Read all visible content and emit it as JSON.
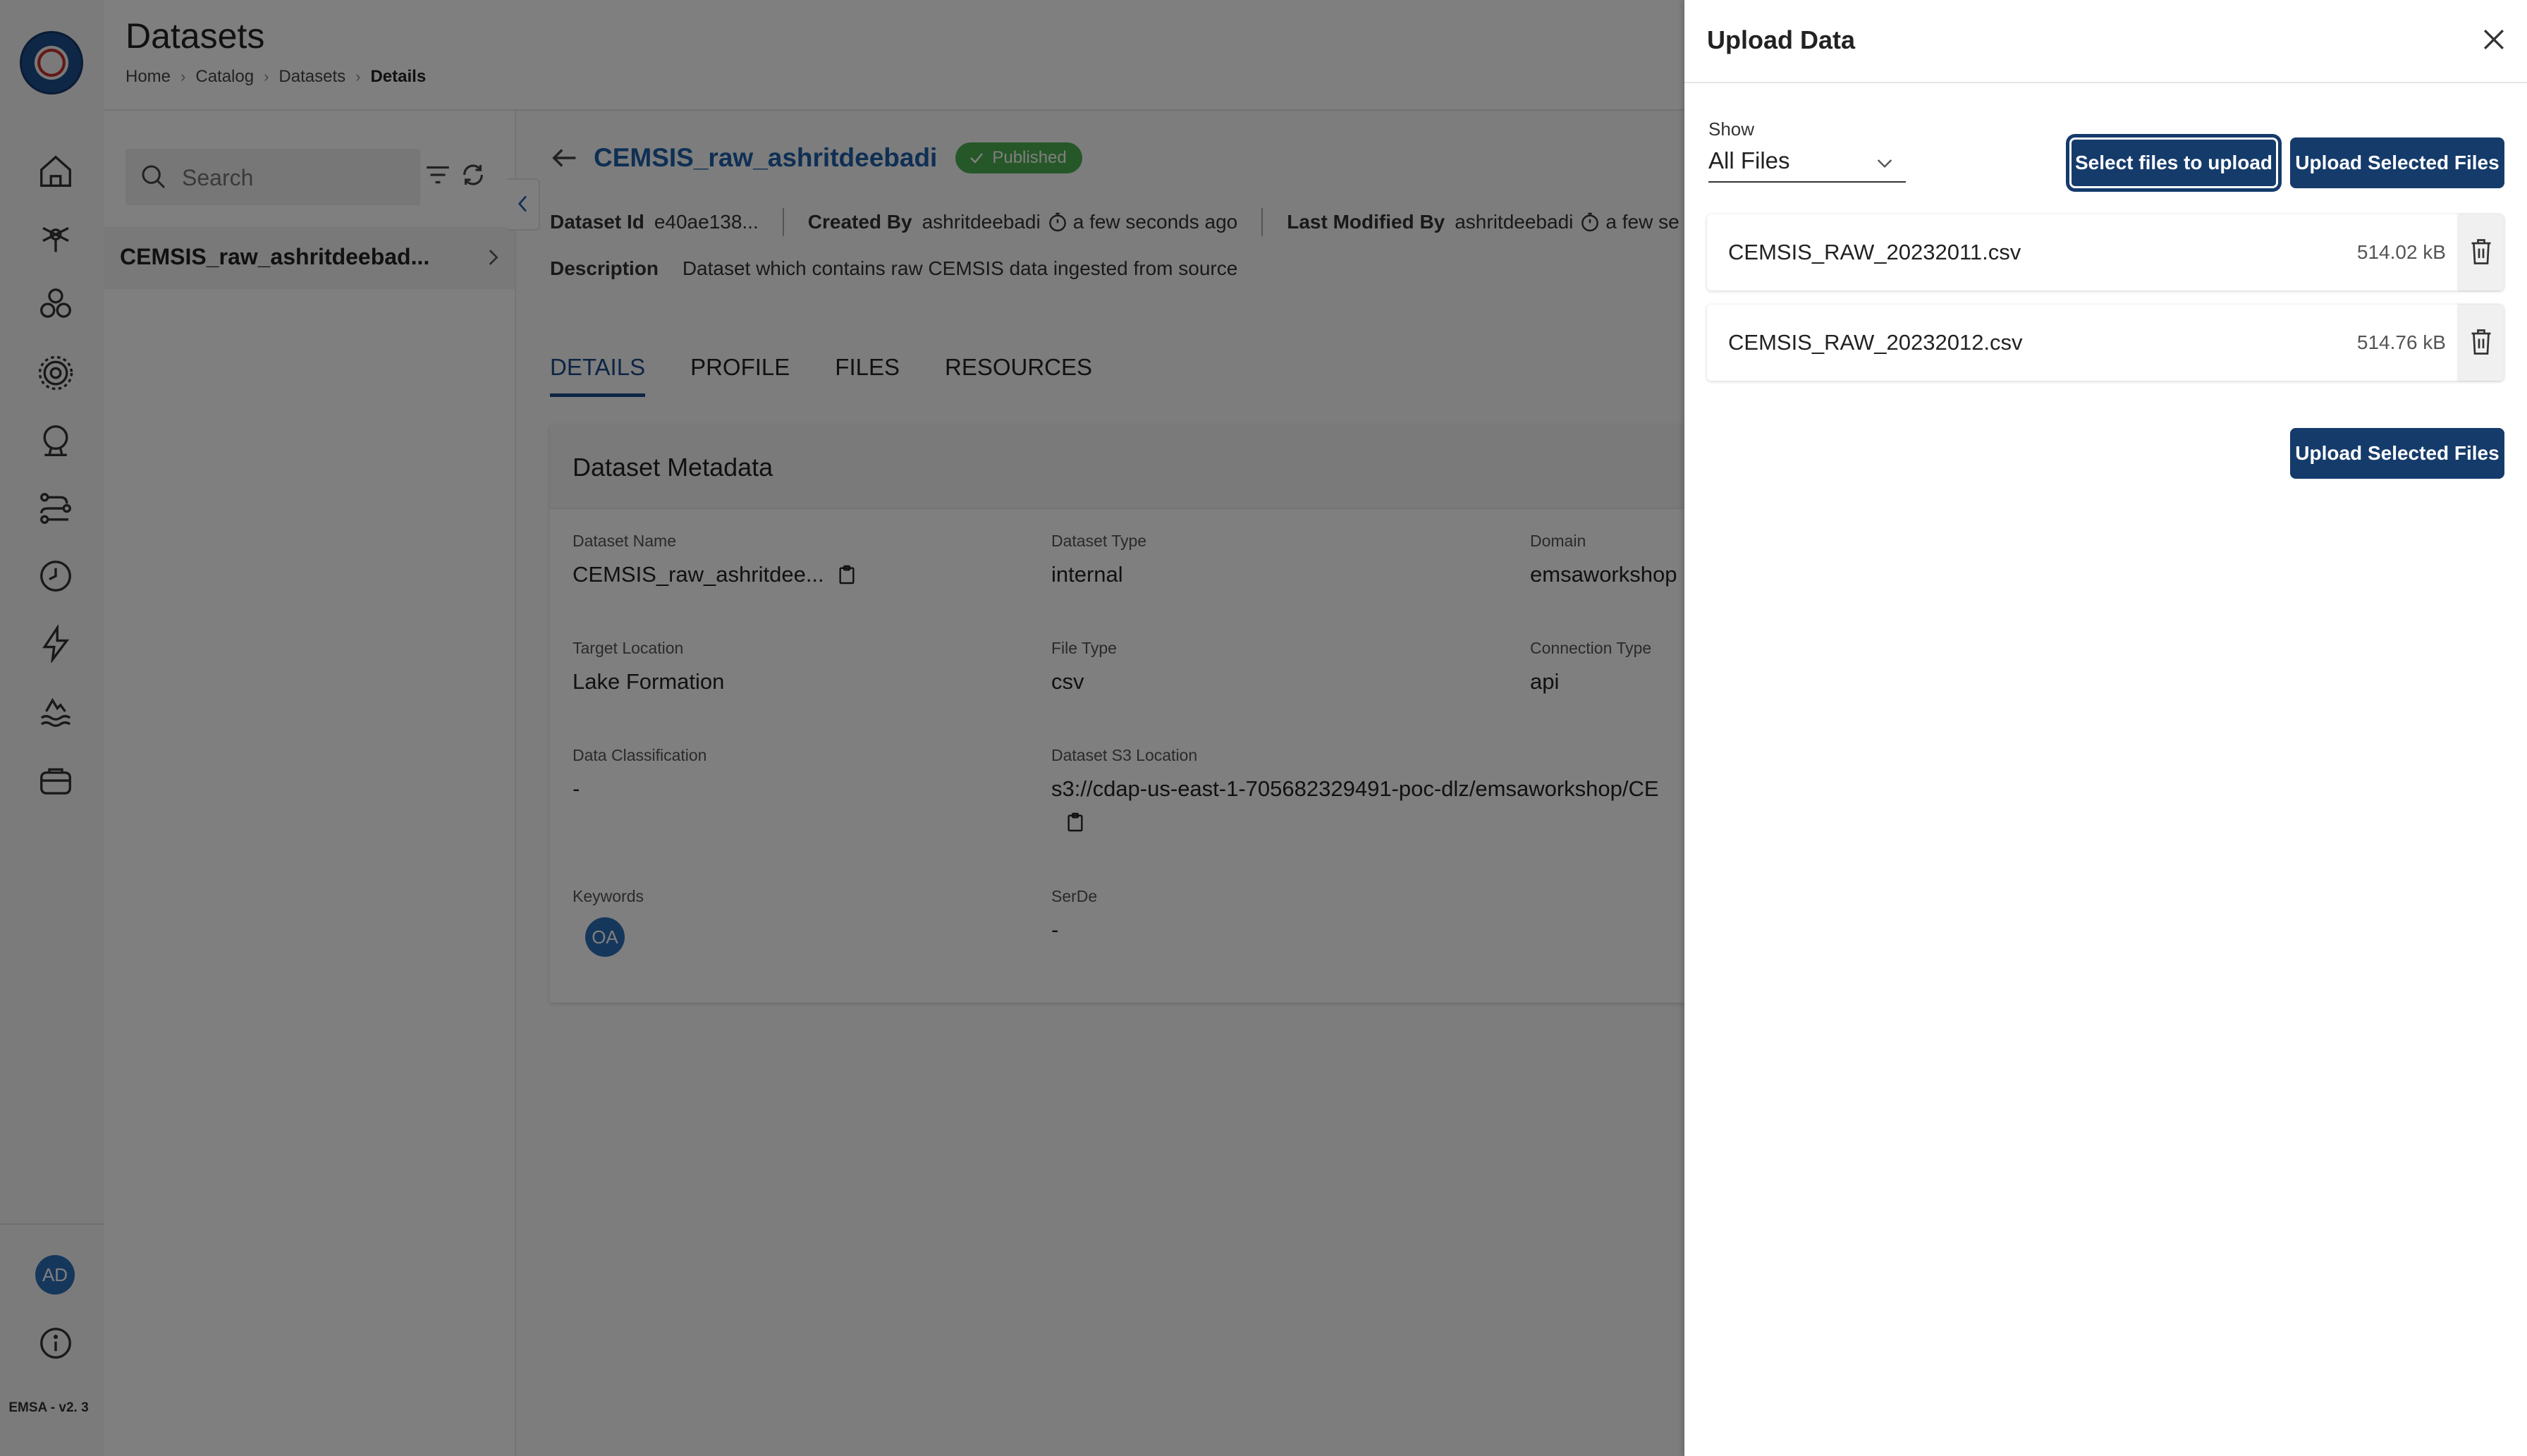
{
  "sidebar": {
    "nav_icons": [
      "home-icon",
      "model-icon",
      "datasets-icon",
      "settings-icon",
      "profile-icon",
      "pipelines-icon",
      "schedule-icon",
      "bolt-icon",
      "lake-icon",
      "storage-icon"
    ],
    "avatar": "AD",
    "version": "EMSA - v2. 3"
  },
  "header": {
    "title": "Datasets",
    "breadcrumb": [
      "Home",
      "Catalog",
      "Datasets",
      "Details"
    ]
  },
  "list": {
    "search_placeholder": "Search",
    "items": [
      {
        "label": "CEMSIS_raw_ashritdeebad..."
      }
    ]
  },
  "dataset": {
    "title": "CEMSIS_raw_ashritdeebadi",
    "status": "Published",
    "meta": {
      "id_label": "Dataset Id",
      "id_value": "e40ae138...",
      "created_label": "Created By",
      "created_by": "ashritdeebadi",
      "created_when": "a few seconds ago",
      "modified_label": "Last Modified By",
      "modified_by": "ashritdeebadi",
      "modified_when": "a few se"
    },
    "description_label": "Description",
    "description": "Dataset which contains raw CEMSIS data ingested from source",
    "tabs": [
      "DETAILS",
      "PROFILE",
      "FILES",
      "RESOURCES"
    ],
    "active_tab": "DETAILS",
    "card_title": "Dataset Metadata",
    "fields": {
      "name": {
        "label": "Dataset Name",
        "value": "CEMSIS_raw_ashritdee..."
      },
      "type": {
        "label": "Dataset Type",
        "value": "internal"
      },
      "domain": {
        "label": "Domain",
        "value": "emsaworkshop"
      },
      "target": {
        "label": "Target Location",
        "value": "Lake Formation"
      },
      "file_type": {
        "label": "File Type",
        "value": "csv"
      },
      "connection": {
        "label": "Connection Type",
        "value": "api"
      },
      "classification": {
        "label": "Data Classification",
        "value": "-"
      },
      "s3": {
        "label": "Dataset S3 Location",
        "value": "s3://cdap-us-east-1-705682329491-poc-dlz/emsaworkshop/CE"
      },
      "keywords": {
        "label": "Keywords",
        "value": "OA"
      },
      "serde": {
        "label": "SerDe",
        "value": "-"
      }
    }
  },
  "upload": {
    "title": "Upload Data",
    "show_label": "Show",
    "show_value": "All Files",
    "select_button": "Select files to upload",
    "upload_button": "Upload Selected Files",
    "files": [
      {
        "name": "CEMSIS_RAW_20232011.csv",
        "size": "514.02 kB"
      },
      {
        "name": "CEMSIS_RAW_20232012.csv",
        "size": "514.76 kB"
      }
    ],
    "upload_button_bottom": "Upload Selected Files"
  },
  "colors": {
    "accent": "#153b6b",
    "link": "#1f5fa9",
    "published": "#4caf50"
  }
}
